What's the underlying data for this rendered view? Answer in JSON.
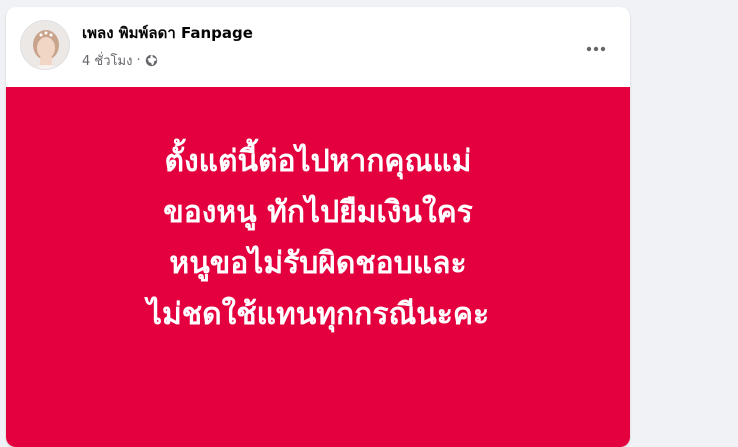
{
  "post": {
    "author": "เพลง พิมพ์ลดา Fanpage",
    "time": "4 ชั่วโมง",
    "separator": "·",
    "audience_icon": "globe-icon",
    "more_icon": "more-dots-icon",
    "background_color": "#e4003f",
    "text_lines": [
      "ตั้งแต่นี้ต่อไปหากคุณแม่",
      "ของหนู ทักไปยืมเงินใคร",
      "หนูขอไม่รับผิดชอบและ",
      "ไม่ชดใช้แทนทุกกรณีนะคะ"
    ]
  }
}
